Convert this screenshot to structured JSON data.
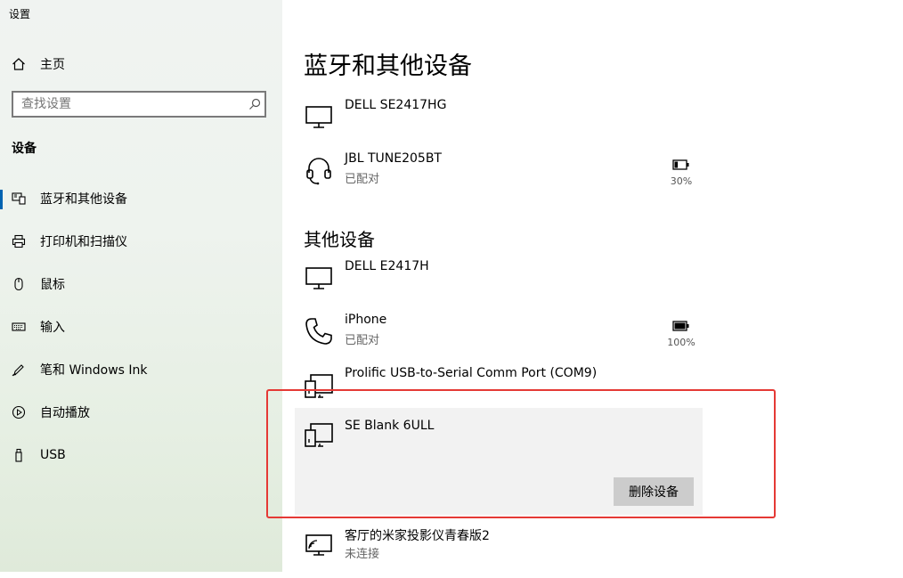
{
  "window": {
    "title": "设置"
  },
  "sidebar": {
    "home_label": "主页",
    "search_placeholder": "查找设置",
    "section_label": "设备",
    "items": [
      {
        "label": "蓝牙和其他设备",
        "icon": "bluetooth-devices-icon",
        "active": true
      },
      {
        "label": "打印机和扫描仪",
        "icon": "printer-icon"
      },
      {
        "label": "鼠标",
        "icon": "mouse-icon"
      },
      {
        "label": "输入",
        "icon": "keyboard-icon"
      },
      {
        "label": "笔和 Windows Ink",
        "icon": "pen-icon"
      },
      {
        "label": "自动播放",
        "icon": "autoplay-icon"
      },
      {
        "label": "USB",
        "icon": "usb-icon"
      }
    ]
  },
  "main": {
    "title": "蓝牙和其他设备",
    "devices_top": [
      {
        "name": "DELL SE2417HG",
        "status": "",
        "icon": "monitor-icon"
      },
      {
        "name": "JBL TUNE205BT",
        "status": "已配对",
        "icon": "headset-icon",
        "battery": "30%",
        "battery_level": 0.3
      }
    ],
    "other_section_label": "其他设备",
    "other_devices": [
      {
        "name": "DELL E2417H",
        "status": "",
        "icon": "monitor-icon"
      },
      {
        "name": "iPhone",
        "status": "已配对",
        "icon": "phone-icon",
        "battery": "100%",
        "battery_level": 1.0
      },
      {
        "name": "Prolific USB-to-Serial Comm Port (COM9)",
        "status": "",
        "icon": "generic-device-icon"
      },
      {
        "name": "SE Blank 6ULL",
        "status": "",
        "icon": "generic-device-icon",
        "selected": true,
        "action_label": "删除设备"
      },
      {
        "name": "客厅的米家投影仪青春版2",
        "status": "未连接",
        "icon": "wireless-display-icon"
      }
    ]
  },
  "colors": {
    "accent": "#0063b1",
    "highlight_border": "#e53935"
  }
}
